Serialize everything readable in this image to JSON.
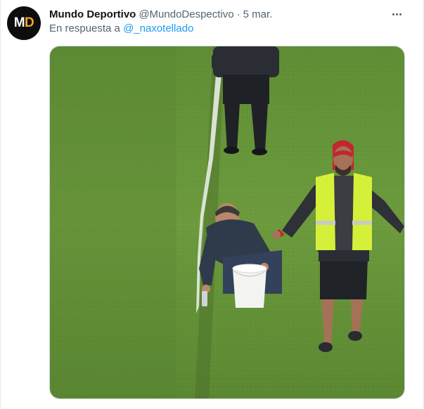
{
  "author": {
    "display_name": "Mundo Deportivo",
    "handle": "@MundoDespectivo",
    "separator": "·",
    "timestamp": "5 mar.",
    "avatar_logo_letters": [
      "M",
      "D"
    ]
  },
  "reply_context": {
    "prefix": "En respuesta a",
    "mention": "@_naxotellado"
  },
  "media": {
    "icon": "photo",
    "description_colors": {
      "grass": "#6d9a3e",
      "line": "#e8ece4",
      "vest": "#d6f03a"
    }
  },
  "icons": {
    "more": "more-horizontal-icon"
  },
  "colors": {
    "text_primary": "#0f1419",
    "text_secondary": "#536471",
    "link": "#1d9bf0",
    "border": "#cfd9de"
  }
}
